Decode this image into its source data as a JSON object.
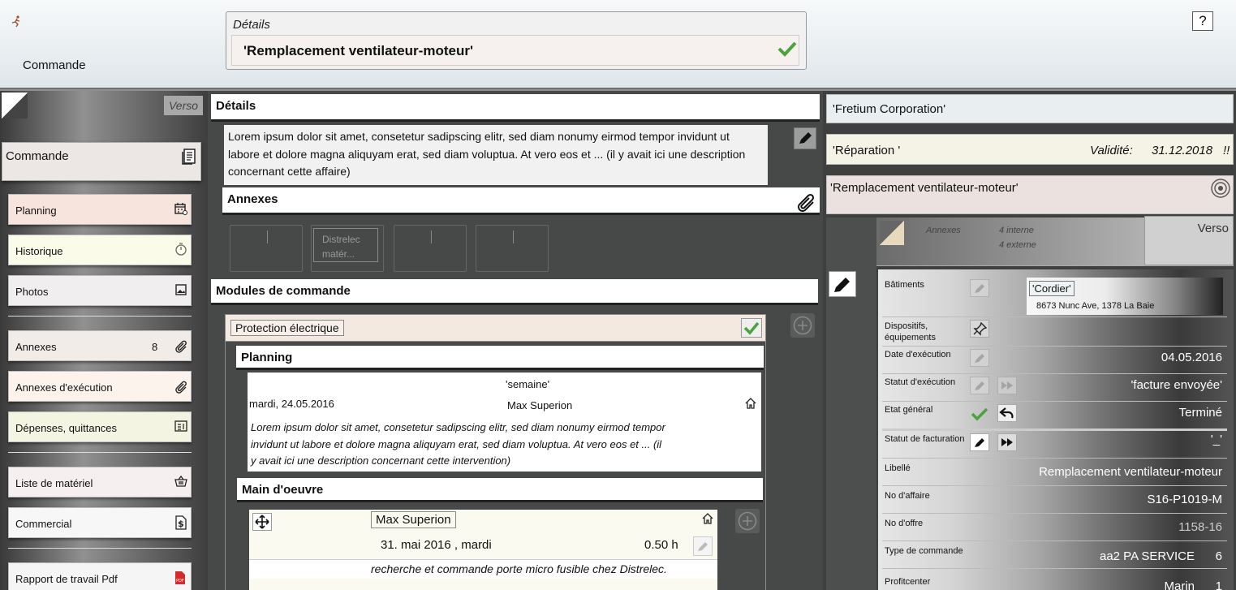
{
  "header": {
    "section": "Commande",
    "details_label": "Détails",
    "details_title": "'Remplacement ventilateur-moteur'",
    "help": "?"
  },
  "left": {
    "verso": "Verso",
    "card_title": "Commande",
    "items": [
      {
        "label": "Planning",
        "icon": "calendar-icon",
        "bg": "#f7e4dc"
      },
      {
        "label": "Historique",
        "icon": "stopwatch-icon",
        "bg": "#fbfbe9"
      },
      {
        "label": "Photos",
        "icon": "image-icon",
        "bg": "#f0eeee"
      },
      {
        "label": "Annexes",
        "count": "8",
        "icon": "paperclip-icon",
        "bg": "#f1ece8"
      },
      {
        "label": "Annexes d'exécution",
        "icon": "paperclip-icon",
        "bg": "#fbf3ec"
      },
      {
        "label": "Dépenses, quittances",
        "icon": "receipt-icon",
        "bg": "#f4f4e2"
      },
      {
        "label": "Liste de matériel",
        "icon": "basket-icon",
        "bg": "#f5eff0"
      },
      {
        "label": "Commercial",
        "icon": "dollar-doc-icon",
        "bg": "#f7f7f7"
      },
      {
        "label": "Rapport de travail Pdf",
        "icon": "pdf-icon",
        "bg": "#f5f5f5"
      }
    ]
  },
  "middle": {
    "details_title": "Détails",
    "description": "Lorem ipsum dolor sit amet, consetetur sadipscing elitr, sed diam nonumy eirmod tempor invidunt ut labore et dolore magna aliquyam erat, sed diam voluptua. At vero eos et ... (il y avait ici une description concernant cette affaire)",
    "annexes_title": "Annexes",
    "thumbnail_text": "Distrelec matér...",
    "modules_title": "Modules de commande",
    "module_name": "Protection électrique",
    "planning_title": "Planning",
    "planning": {
      "week": "'semaine'",
      "date": "mardi, 24.05.2016",
      "person": "Max Superion",
      "description": "Lorem ipsum dolor sit amet, consetetur sadipscing elitr, sed diam nonumy eirmod tempor invidunt ut labore et dolore magna aliquyam erat, sed diam voluptua. At vero eos et ... (il y avait ici une description concernant cette intervention)"
    },
    "labour_title": "Main d'oeuvre",
    "labour": {
      "person": "Max Superion",
      "date": "31. mai 2016 , mardi",
      "hours": "0.50 h",
      "description": "recherche et commande porte micro fusible chez Distrelec."
    }
  },
  "right": {
    "company": "'Fretium Corporation'",
    "type": "'Réparation '",
    "validity_label": "Validité:",
    "validity_date": "31.12.2018",
    "validity_flag": "!!",
    "title": "'Remplacement ventilateur-moteur'",
    "annexes_label": "Annexes",
    "annexes_internal": "4 interne",
    "annexes_external": "4 externe",
    "verso": "Verso",
    "building_label": "Bâtiments",
    "building_name": "'Cordier'",
    "building_address": "8673 Nunc Ave, 1378 La Baie",
    "devices_label": "Dispositifs, équipements",
    "exec_date_label": "Date d'exécution",
    "exec_date": "04.05.2016",
    "exec_status_label": "Statut d'exécution",
    "exec_status": "'facture envoyée'",
    "general_label": "Etat général",
    "general_value": "Terminé",
    "billing_label": "Statut de facturation",
    "billing_value": "'_'",
    "libelle_label": "Libellé",
    "libelle_value": "Remplacement ventilateur-moteur",
    "affaire_label": "No d'affaire",
    "affaire_value": "S16-P1019-M",
    "offre_label": "No d'offre",
    "offre_value": "1158-16",
    "cmdtype_label": "Type de commande",
    "cmdtype_value": "aa2 PA SERVICE",
    "cmdtype_num": "6",
    "profit_label": "Profitcenter",
    "profit_value": "Marin",
    "profit_num": "1"
  }
}
